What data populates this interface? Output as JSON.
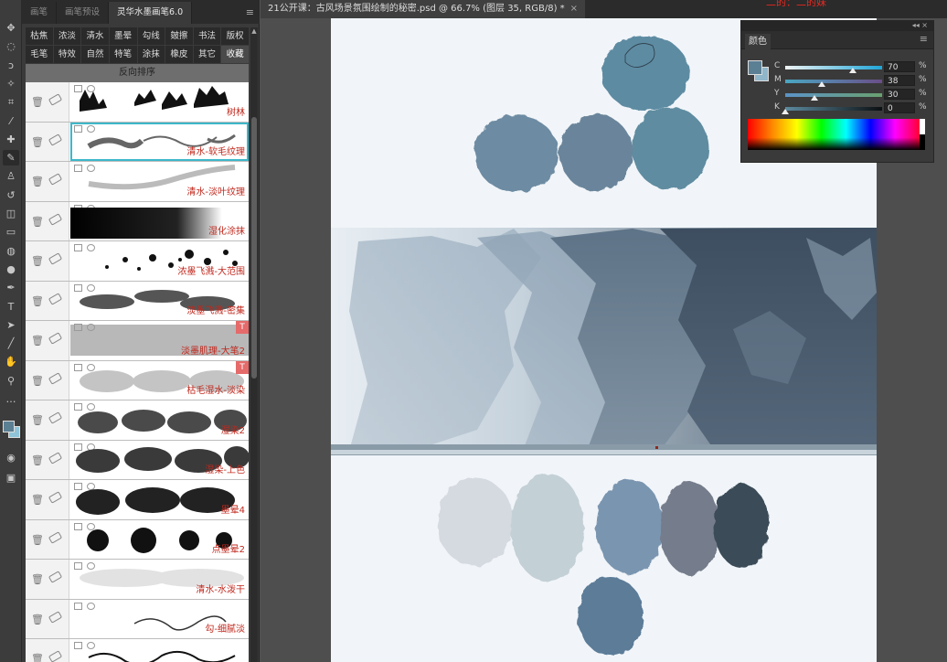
{
  "document": {
    "tab_title": "21公开课：古风场景氛围绘制的秘密.psd @ 66.7% (图层 35, RGB/8) *",
    "close_glyph": "×"
  },
  "overlay_text": "二的：二的妹",
  "brush_panel": {
    "tabs": [
      {
        "label": "画笔"
      },
      {
        "label": "画笔预设"
      },
      {
        "label": "灵华水墨画笔6.0"
      }
    ],
    "categories_row1": [
      "枯焦",
      "浓淡",
      "清水",
      "墨晕",
      "勾线",
      "皴擦",
      "书法",
      "版权"
    ],
    "categories_row2": [
      "毛笔",
      "特效",
      "自然",
      "特笔",
      "涂抹",
      "橡皮",
      "其它",
      "收藏"
    ],
    "active_category": "收藏",
    "sort_header": "反向排序",
    "brushes": [
      {
        "name": "树林"
      },
      {
        "name": "清水-软毛纹理",
        "selected": true
      },
      {
        "name": "清水-淡叶纹理"
      },
      {
        "name": "湿化涂抹"
      },
      {
        "name": "浓墨飞溅-大范围"
      },
      {
        "name": "淡墨飞溅-密集"
      },
      {
        "name": "淡墨肌理-大笔2",
        "badge": "T"
      },
      {
        "name": "枯毛湿水-淡染",
        "badge": "T"
      },
      {
        "name": "湿染2"
      },
      {
        "name": "湿染-上色"
      },
      {
        "name": "墨晕4"
      },
      {
        "name": "点墨晕2"
      },
      {
        "name": "清水-水泼干"
      },
      {
        "name": "勾-细腻淡"
      },
      {
        "name": ""
      }
    ],
    "menu_glyph": "≡"
  },
  "color_panel": {
    "title": "颜色",
    "menu_glyph": "≡",
    "collapse_glyph": "◂◂  ×",
    "fg_color": "#5b7f93",
    "bg_color": "#8fb6c9",
    "sliders": [
      {
        "label": "C",
        "value": "70",
        "pct": "%",
        "fraction": 0.7,
        "from": "#f0f4f4",
        "to": "#1fa6d8"
      },
      {
        "label": "M",
        "value": "38",
        "pct": "%",
        "fraction": 0.38,
        "from": "#4aa6c2",
        "to": "#6a4e88"
      },
      {
        "label": "Y",
        "value": "30",
        "pct": "%",
        "fraction": 0.3,
        "from": "#5b93c6",
        "to": "#6aa070"
      },
      {
        "label": "K",
        "value": "0",
        "pct": "%",
        "fraction": 0.0,
        "from": "#5c8a9f",
        "to": "#0b0f12"
      }
    ]
  },
  "toolbar": {
    "tools": [
      "move-icon",
      "marquee-icon",
      "lasso-icon",
      "magic-wand-icon",
      "crop-icon",
      "eyedropper-icon",
      "healing-icon",
      "brush-icon",
      "stamp-icon",
      "history-brush-icon",
      "eraser-icon",
      "gradient-icon",
      "blur-icon",
      "dodge-icon",
      "pen-icon",
      "type-icon",
      "path-select-icon",
      "line-icon",
      "hand-icon",
      "zoom-icon",
      "more-icon"
    ],
    "fg_color": "#5b7f93",
    "bg_color": "#8fc4d8"
  },
  "canvas_colors": {
    "top_blobs": [
      "#5d8ba2",
      "#6d8ba2",
      "#6b859b",
      "#5e8ca0"
    ],
    "bottom_blobs": [
      "#d5d9e0",
      "#c3d0d6",
      "#7a95b0",
      "#757b8b",
      "#3b4b58",
      "#5b7c98"
    ]
  }
}
